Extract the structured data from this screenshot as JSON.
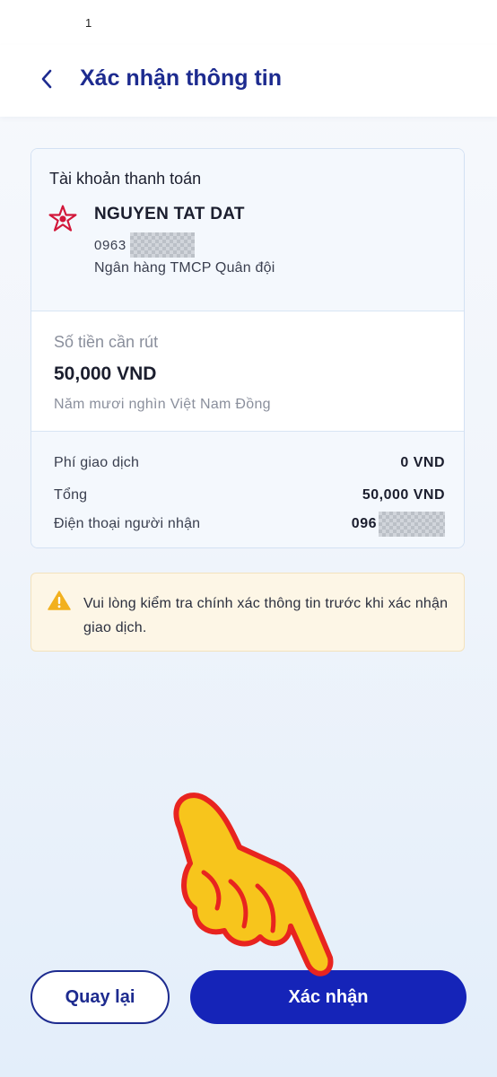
{
  "status_bar": {
    "text": "1"
  },
  "header": {
    "title": "Xác nhận thông tin",
    "back_icon": "chevron-left-icon"
  },
  "account": {
    "section_title": "Tài khoản thanh toán",
    "name": "NGUYEN TAT DAT",
    "number_prefix": "0963",
    "bank": "Ngân hàng TMCP Quân đội",
    "logo_icon": "mb-bank-star-icon",
    "logo_color": "#d2173a"
  },
  "amount": {
    "label": "Số tiền cần rút",
    "value": "50,000 VND",
    "words": "Năm mươi nghìn Việt Nam Đồng"
  },
  "details": {
    "fee_label": "Phí giao dịch",
    "fee_value": "0 VND",
    "total_label": "Tổng",
    "total_value": "50,000 VND",
    "phone_label": "Điện thoại người nhận",
    "phone_prefix": "096"
  },
  "warning": {
    "icon": "warning-triangle-icon",
    "text": "Vui lòng kiểm tra chính xác thông tin trước khi xác nhận giao dịch."
  },
  "buttons": {
    "back_label": "Quay lại",
    "confirm_label": "Xác nhận"
  },
  "colors": {
    "primary": "#1d2b8f",
    "button_fill": "#1524b8",
    "warning_bg": "#fdf6e6",
    "warning_icon": "#f2b01e",
    "pointer_hand": "#f7c51c",
    "pointer_outline": "#e8241f"
  }
}
